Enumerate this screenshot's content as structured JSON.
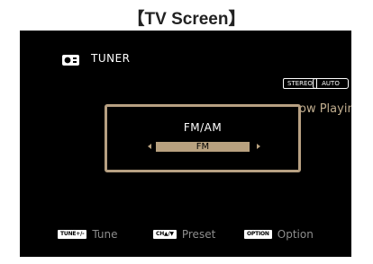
{
  "caption": "【TV Screen】",
  "source": {
    "icon": "radio-icon",
    "label": "TUNER"
  },
  "indicators": {
    "stereo": "STEREO",
    "auto": "AUTO"
  },
  "background_text": "ow Playing",
  "dialog": {
    "title": "FM/AM",
    "selected_value": "FM"
  },
  "footer": {
    "tune_key": "TUNE+/-",
    "tune_label": "Tune",
    "preset_key": "CH▲/▼",
    "preset_label": "Preset",
    "option_key": "OPTION",
    "option_label": "Option"
  },
  "colors": {
    "accent": "#b8a17f",
    "screen_bg": "#000000",
    "text": "#ffffff",
    "muted_text": "#8d8d8d"
  }
}
